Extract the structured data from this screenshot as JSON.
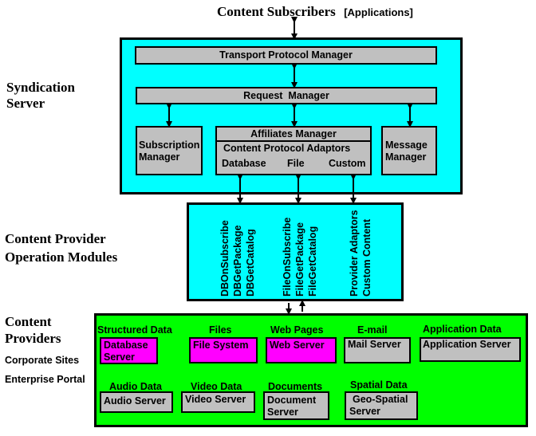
{
  "top": {
    "title": "Content Subscribers",
    "subtitle": "[Applications]"
  },
  "side_labels": {
    "syndication": [
      "Syndication",
      "Server"
    ],
    "operation": [
      "Content Provider",
      "Operation Modules"
    ],
    "providers": [
      "Content",
      "Providers"
    ],
    "provider_examples": [
      "Corporate Sites",
      "Enterprise Portal"
    ]
  },
  "syndication_server": {
    "transport": "Transport Protocol Manager",
    "request": "Request  Manager",
    "subscription": [
      "Subscription",
      "Manager"
    ],
    "affiliates": "Affiliates Manager",
    "adaptors_title": "Content Protocol Adaptors",
    "adaptors": [
      "Database",
      "File",
      "Custom"
    ],
    "message": [
      "Message",
      "Manager"
    ]
  },
  "operation_modules": {
    "db": [
      "DBGetCatalog",
      "DBGetPackage",
      "DBOnSubscribe"
    ],
    "file": [
      "FileGetCatalog",
      "FileGetPackage",
      "FileOnSubscribe"
    ],
    "custom": [
      "Custom Content",
      "Provider Adaptors"
    ]
  },
  "providers": {
    "row1": [
      {
        "category": "Structured Data",
        "server": [
          "Database",
          "Server"
        ],
        "color": "#ff00ff"
      },
      {
        "category": "Files",
        "server": [
          "File System"
        ],
        "color": "#ff00ff"
      },
      {
        "category": "Web Pages",
        "server": [
          "Web Server"
        ],
        "color": "#ff00ff"
      },
      {
        "category": "E-mail",
        "server": [
          "Mail Server"
        ],
        "color": "#c0c0c0"
      },
      {
        "category": "Application Data",
        "server": [
          "Application Server"
        ],
        "color": "#c0c0c0"
      }
    ],
    "row2": [
      {
        "category": "Audio Data",
        "server": [
          "Audio Server"
        ],
        "color": "#c0c0c0"
      },
      {
        "category": "Video Data",
        "server": [
          "Video Server"
        ],
        "color": "#c0c0c0"
      },
      {
        "category": "Documents",
        "server": [
          "Document",
          "Server"
        ],
        "color": "#c0c0c0"
      },
      {
        "category": "Spatial Data",
        "server": [
          "Geo-Spatial",
          "Server"
        ],
        "color": "#c0c0c0"
      }
    ]
  },
  "colors": {
    "syndication_bg": "#00ffff",
    "operation_bg": "#00ffff",
    "providers_bg": "#00ff00",
    "component_gray": "#c0c0c0",
    "highlight_magenta": "#ff00ff"
  }
}
